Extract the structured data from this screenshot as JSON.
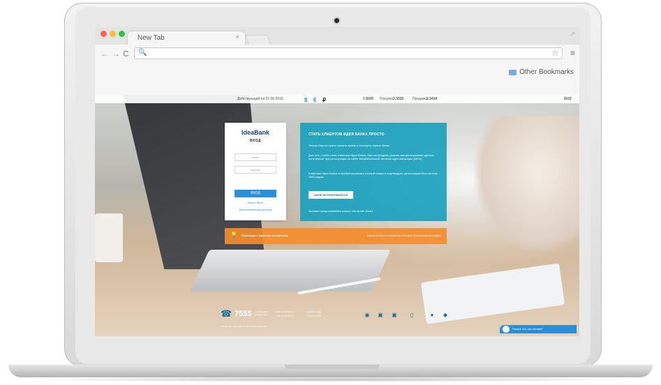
{
  "browser": {
    "tab_title": "New Tab",
    "tab_close": "×",
    "address_value": "",
    "search_glyph": "🔍",
    "bookmarks": [
      "Other Bookmarks"
    ],
    "nav": {
      "back": "←",
      "forward": "→",
      "reload": "C"
    },
    "star": "☆",
    "menu": "≡",
    "resize": "↗",
    "light_colors": [
      "#ff5f57",
      "#febc2e",
      "#28c840"
    ]
  },
  "page": {
    "topbar": {
      "rates_date": "Действующий на 01.06.2016",
      "currencies": [
        "$",
        "€",
        "₽"
      ],
      "currency_code": "1 BUR",
      "buy_label": "Покупка",
      "buy_value": "2.3520",
      "sell_label": "Продажа",
      "sell_value": "2.3410",
      "lang": "RUS"
    },
    "login": {
      "brand": "IdeaBank",
      "title": "ВХОД",
      "login_placeholder": "Логин",
      "password_placeholder": "Пароль",
      "submit_label": "ВХОД",
      "link_mdm": "Войти МСИ",
      "link_restore": "Восстановление доступа"
    },
    "promo": {
      "title": "СТАТЬ КЛИЕНТОМ ИДЕЯ БАНКА ПРОСТО",
      "p1": "Теперь Вам не нужно тратить время и посещать офисы банка",
      "p2": "Для того, чтобы стать клиентом Идея Банка, Вам необходимо указать авторизационные данные, полученные при регистрации на сайте Межбанковской системы идентификации (МСИ).",
      "p3": "Клиентам Идея Банка потребуется указать личный номер и подтвердить регистрацию бесплатным SMS-кодом.",
      "button_label": "ЗАРЕГИСТРИРОВАТЬСЯ",
      "note": "Условия предоставления услуги «Интернет-банк»"
    },
    "orange_banner": {
      "left": "Переводы с карточки на карточку",
      "right": "Карточки Visa и MasterCard банков Республики Беларусь"
    },
    "footer": {
      "phone": "7555",
      "phone_note": "с мобильных операторов",
      "phone2": "+375 17 306-55-14",
      "phone3": "+375 17 306-55-16",
      "phone2_note": "единый номер",
      "phone3_note": "телефон-факс",
      "copyright": "© 2016 ЗАО «Идея Банк». Все права защищены",
      "chat_label": "Начать чат, мы онлайн!"
    }
  }
}
